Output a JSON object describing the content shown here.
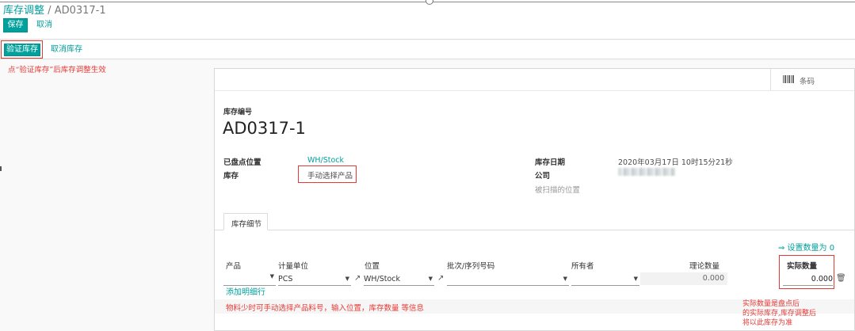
{
  "breadcrumb": {
    "parent": "库存调整",
    "sep": "/",
    "current": "AD0317-1"
  },
  "actions": {
    "save": "保存",
    "discard": "取消"
  },
  "statusbar": {
    "validate": "验证库存",
    "cancel": "取消库存"
  },
  "notes": {
    "validate": "点“验证库存”后库存调整生效",
    "manual": "物料少时可手动选择产品料号，输入位置，库存数量 等信息",
    "counted_1": "实际数量是盘点后",
    "counted_2": "的实际库存,库存调整后",
    "counted_3": "将以此库存为准"
  },
  "sheet": {
    "barcode_label": "条码",
    "ref_label": "库存编号",
    "ref_value": "AD0317-1",
    "fields": {
      "location_label": "已盘点位置",
      "location_value": "WH/Stock",
      "inventory_label": "库存",
      "inventory_value": "手动选择产品",
      "date_label": "库存日期",
      "date_value": "2020年03月17日 10时15分21秒",
      "company_label": "公司",
      "scanned_location": "被扫描的位置"
    },
    "tab_label": "库存细节",
    "set_quantity": "⇒ 设置数量为 0",
    "table": {
      "headers": [
        "产品",
        "计量单位",
        "位置",
        "批次/序列号码",
        "所有者",
        "理论数量",
        "实际数量"
      ],
      "row": {
        "product": "",
        "uom": "PCS",
        "location": "WH/Stock",
        "lot": "",
        "owner": "",
        "theoretical": "0.000",
        "counted": "0.000"
      },
      "add_line": "添加明细行"
    }
  },
  "colors": {
    "primary": "#00a09d",
    "annotation": "#e53935"
  }
}
